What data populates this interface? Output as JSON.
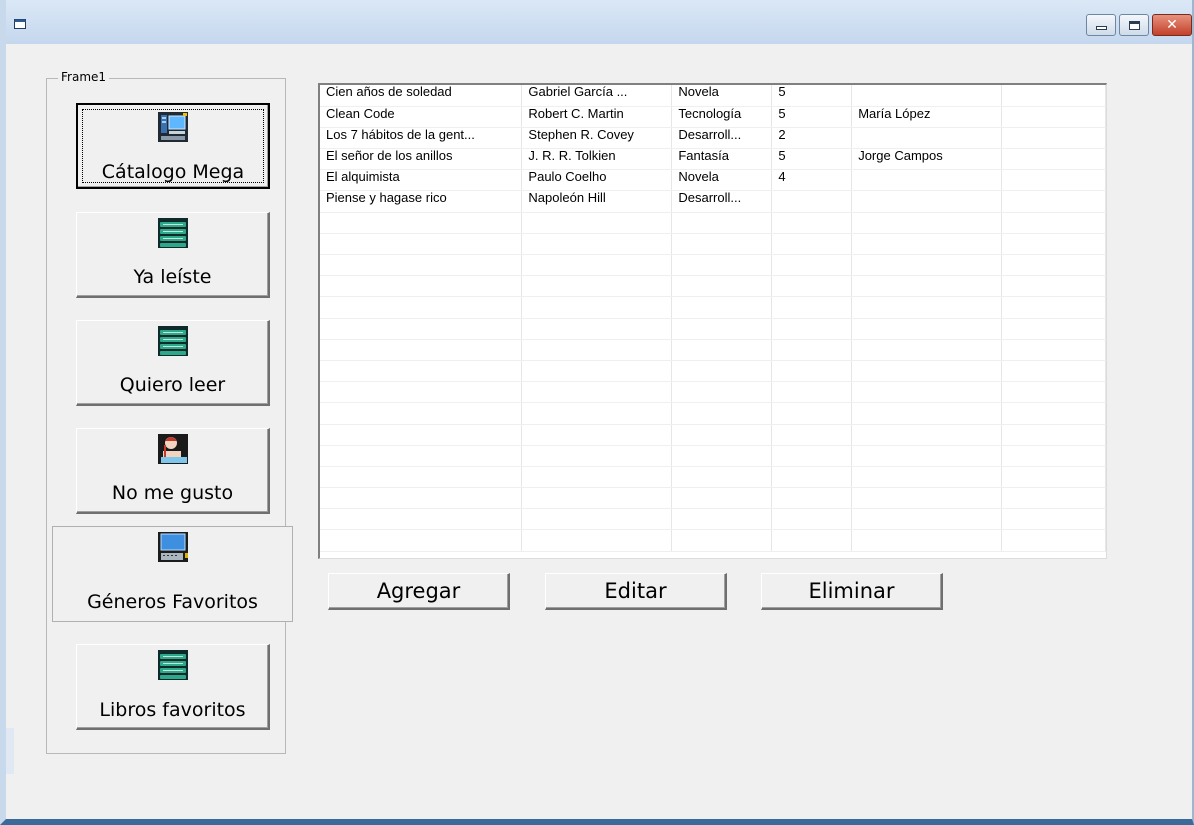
{
  "window": {
    "title": "",
    "controls": {
      "minimize": "minimize",
      "maximize": "maximize",
      "close": "✕"
    }
  },
  "frame": {
    "caption": "Frame1",
    "buttons": [
      {
        "label": "Cátalogo Mega",
        "icon": "computer-icon"
      },
      {
        "label": "Ya leíste",
        "icon": "books-stack-icon"
      },
      {
        "label": "Quiero leer",
        "icon": "books-stack-icon"
      },
      {
        "label": "No me gusto",
        "icon": "reader-icon"
      },
      {
        "label": "Géneros Favoritos",
        "icon": "computer-keyboard-icon"
      },
      {
        "label": "Libros favoritos",
        "icon": "books-stack-icon"
      }
    ]
  },
  "grid": {
    "rows": [
      [
        "Cien años de soledad",
        "Gabriel García ...",
        "Novela",
        "5",
        "",
        ""
      ],
      [
        "Clean Code",
        "Robert C. Martin",
        "Tecnología",
        "5",
        "María López",
        ""
      ],
      [
        "Los 7 hábitos de la gent...",
        "Stephen R. Covey",
        "Desarroll...",
        "2",
        "",
        ""
      ],
      [
        "El señor de los anillos",
        "J. R. R. Tolkien",
        "Fantasía",
        "5",
        "Jorge Campos",
        ""
      ],
      [
        "El alquimista",
        "Paulo Coelho",
        "Novela",
        "4",
        "",
        ""
      ],
      [
        "Piense y hagase rico",
        "Napoleón Hill",
        "Desarroll...",
        "",
        "",
        ""
      ]
    ]
  },
  "actions": {
    "add": "Agregar",
    "edit": "Editar",
    "delete": "Eliminar"
  },
  "colors": {
    "titlebar": "#c5d7ee",
    "face": "#f0f0f0",
    "close": "#c3402a"
  }
}
